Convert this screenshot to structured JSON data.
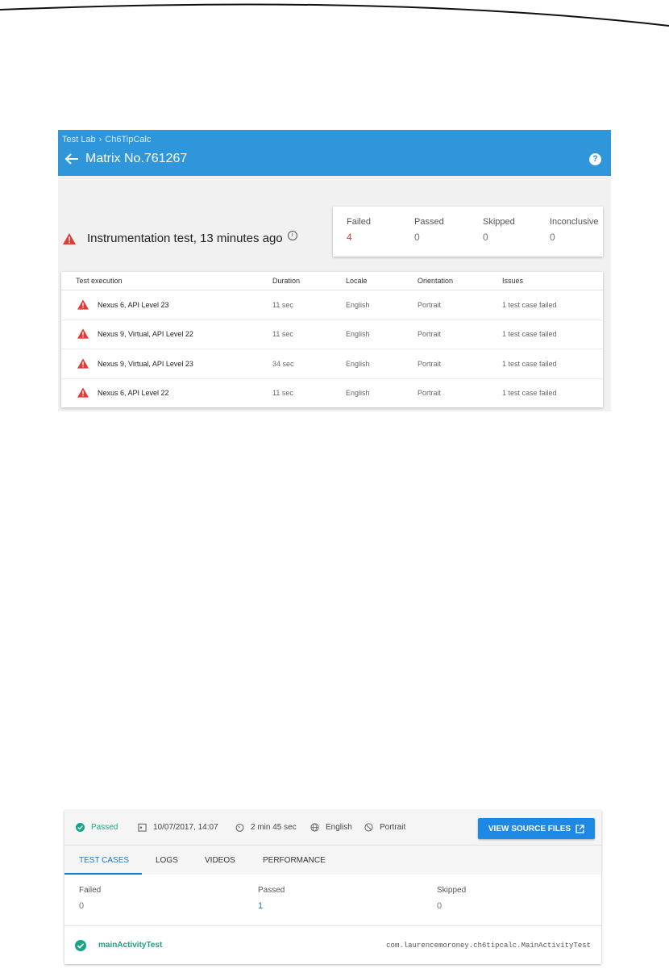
{
  "screenshot1": {
    "breadcrumb": [
      "Test Lab",
      "Ch6TipCalc"
    ],
    "breadcrumb_separator": "›",
    "title": "Matrix No.761267",
    "help_icon": "?",
    "summary": "Instrumentation test, 13 minutes ago",
    "info_icon": "i",
    "stats": [
      {
        "label": "Failed",
        "value": "4"
      },
      {
        "label": "Passed",
        "value": "0"
      },
      {
        "label": "Skipped",
        "value": "0"
      },
      {
        "label": "Inconclusive",
        "value": "0"
      }
    ],
    "table": {
      "headers": [
        "Test execution",
        "Duration",
        "Locale",
        "Orientation",
        "Issues"
      ],
      "rows": [
        {
          "name": "Nexus 6, API Level 23",
          "duration": "11 sec",
          "locale": "English",
          "orientation": "Portrait",
          "issues": "1 test case failed"
        },
        {
          "name": "Nexus 9, Virtual, API Level 22",
          "duration": "11 sec",
          "locale": "English",
          "orientation": "Portrait",
          "issues": "1 test case failed"
        },
        {
          "name": "Nexus 9, Virtual, API Level 23",
          "duration": "34 sec",
          "locale": "English",
          "orientation": "Portrait",
          "issues": "1 test case failed"
        },
        {
          "name": "Nexus 6, API Level 22",
          "duration": "11 sec",
          "locale": "English",
          "orientation": "Portrait",
          "issues": "1 test case failed"
        }
      ]
    },
    "colors": {
      "header": "#2f96dc",
      "failed": "#e53935"
    }
  },
  "screenshot2": {
    "status": "Passed",
    "date": "10/07/2017, 14:07",
    "duration": "2 min 45 sec",
    "locale": "English",
    "orientation": "Portrait",
    "view_source_label": "VIEW SOURCE FILES",
    "tabs": [
      "TEST CASES",
      "LOGS",
      "VIDEOS",
      "PERFORMANCE"
    ],
    "counts": [
      {
        "label": "Failed",
        "value": "0"
      },
      {
        "label": "Passed",
        "value": "1"
      },
      {
        "label": "Skipped",
        "value": "0"
      }
    ],
    "test_case": {
      "name": "mainActivityTest",
      "class": "com.laurencemoroney.ch6tipcalc.MainActivityTest"
    },
    "colors": {
      "passed": "#17a589",
      "button": "#1e88e5"
    }
  }
}
